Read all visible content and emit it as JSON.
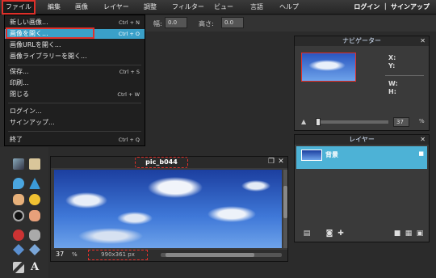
{
  "menubar": {
    "items": [
      "ファイル",
      "編集",
      "画像",
      "レイヤー",
      "調整",
      "フィルター",
      "ビュー",
      "言語",
      "ヘルプ"
    ],
    "login": "ログイン ｜ サインアップ"
  },
  "options": {
    "width_label": "幅:",
    "width_value": "0.0",
    "height_label": "高さ:",
    "height_value": "0.0"
  },
  "file_menu": {
    "items": [
      {
        "label": "新しい画像...",
        "shortcut": "Ctrl + N"
      },
      {
        "label": "画像を開く...",
        "shortcut": "Ctrl + O"
      },
      {
        "label": "画像URLを開く...",
        "shortcut": ""
      },
      {
        "label": "画像ライブラリーを開く...",
        "shortcut": ""
      },
      {
        "label": "保存...",
        "shortcut": "Ctrl + S"
      },
      {
        "label": "印刷...",
        "shortcut": ""
      },
      {
        "label": "閉じる",
        "shortcut": "Ctrl + W"
      },
      {
        "label": "ログイン...",
        "shortcut": ""
      },
      {
        "label": "サインアップ...",
        "shortcut": ""
      },
      {
        "label": "終了",
        "shortcut": "Ctrl + Q"
      }
    ]
  },
  "image_window": {
    "name": "pic_b044",
    "zoom": "37",
    "zoom_unit": "%",
    "dimensions": "990x361 px",
    "restore_icon": "❐",
    "close_icon": "✕"
  },
  "navigator": {
    "title": "ナビゲーター",
    "x_label": "X:",
    "y_label": "Y:",
    "w_label": "W:",
    "h_label": "H:",
    "zoom": "37",
    "zoom_unit": "%",
    "close_icon": "✕"
  },
  "layers": {
    "title": "レイヤー",
    "layer_name": "背景",
    "close_icon": "✕"
  },
  "colors": {
    "accent": "#3aa0c8",
    "highlight": "#e0302a",
    "menubar": "#262626"
  }
}
